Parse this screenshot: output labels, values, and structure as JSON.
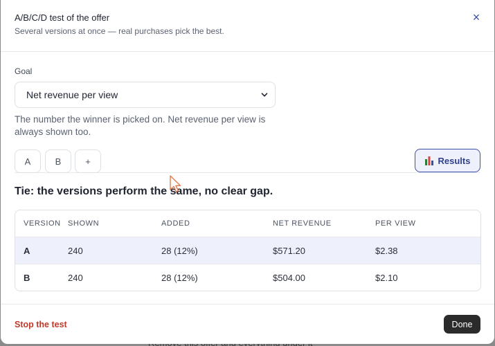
{
  "backdrop": {
    "text": "Remove this offer and everything under it"
  },
  "modal": {
    "title": "A/B/C/D test of the offer",
    "subtitle": "Several versions at once — real purchases pick the best.",
    "close_icon": "×"
  },
  "goal": {
    "label": "Goal",
    "selected": "Net revenue per view",
    "help": "The number the winner is picked on. Net revenue per view is always shown too."
  },
  "tabs": [
    {
      "label": "A"
    },
    {
      "label": "B"
    },
    {
      "label": "+"
    }
  ],
  "results_button": {
    "label": "Results",
    "icon": "bar-chart-icon"
  },
  "verdict": "Tie: the versions perform the same, no clear gap.",
  "table": {
    "headers": [
      "VERSION",
      "SHOWN",
      "ADDED",
      "NET REVENUE",
      "PER VIEW"
    ],
    "rows": [
      {
        "version": "A",
        "shown": "240",
        "added": "28 (12%)",
        "net_revenue": "$571.20",
        "per_view": "$2.38",
        "highlight": true
      },
      {
        "version": "B",
        "shown": "240",
        "added": "28 (12%)",
        "net_revenue": "$504.00",
        "per_view": "$2.10",
        "highlight": false
      }
    ]
  },
  "footer": {
    "stop_label": "Stop the test",
    "done_label": "Done"
  },
  "colors": {
    "accent": "#3b4ea8",
    "danger": "#c0392b",
    "highlight_row": "#eef1fb"
  }
}
